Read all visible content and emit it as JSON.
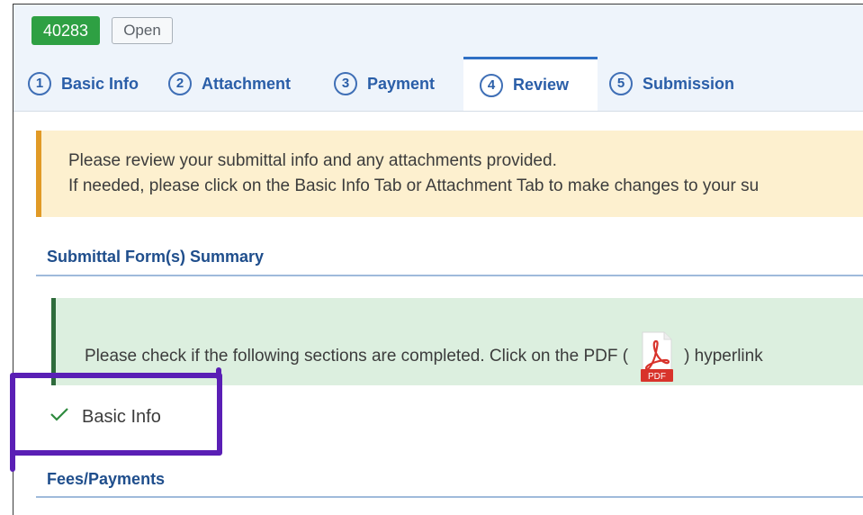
{
  "header": {
    "id_badge": "40283",
    "status_badge": "Open"
  },
  "tabs": [
    {
      "number": "1",
      "label": "Basic Info"
    },
    {
      "number": "2",
      "label": "Attachment"
    },
    {
      "number": "3",
      "label": "Payment"
    },
    {
      "number": "4",
      "label": "Review"
    },
    {
      "number": "5",
      "label": "Submission"
    }
  ],
  "active_tab": "Review",
  "warning": {
    "line1": "Please review your submittal info and any attachments provided.",
    "line2": "If needed, please click on the Basic Info Tab or Attachment Tab to make changes to your su"
  },
  "summary_title": "Submittal Form(s) Summary",
  "info": {
    "text_before": "Please check if the following sections are completed. Click on the PDF (",
    "text_after": ") hyperlink",
    "pdf_label": "PDF"
  },
  "checklist": [
    {
      "label": "Basic Info",
      "icon": "check-icon"
    }
  ],
  "fees_title": "Fees/Payments",
  "colors": {
    "id_badge": "#2ea043",
    "link_blue": "#2a5ea8",
    "warning_bg": "#fdf0cf",
    "warning_border": "#e19a26",
    "success_bg": "#dcefdf",
    "highlight": "#5a1fb5"
  }
}
